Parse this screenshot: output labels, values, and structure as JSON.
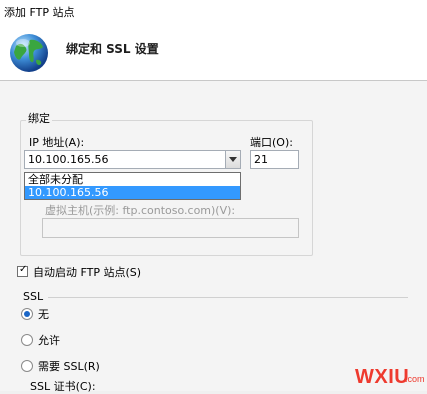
{
  "window": {
    "title": "添加 FTP 站点"
  },
  "header": {
    "title": "绑定和 SSL 设置",
    "icon": "globe-icon"
  },
  "binding": {
    "group_label": "绑定",
    "ip_label": "IP 地址(A):",
    "ip_value": "10.100.165.56",
    "ip_options": [
      "全部未分配",
      "10.100.165.56"
    ],
    "ip_selected_index": 1,
    "port_label": "端口(O):",
    "port_value": "21",
    "virtual_host_label": "虚拟主机(示例: ftp.contoso.com)(V):",
    "virtual_host_value": ""
  },
  "auto_start": {
    "label": "自动启动 FTP 站点(S)",
    "checked": true
  },
  "ssl": {
    "section_label": "SSL",
    "options": [
      "无",
      "允许",
      "需要 SSL(R)"
    ],
    "selected": "无",
    "cert_label": "SSL 证书(C):"
  },
  "watermark": {
    "text": "WXIU",
    "sub": ".com"
  },
  "colors": {
    "selection": "#3399ff",
    "radio_dot": "#1a66c7",
    "watermark": "#ee3a2e"
  }
}
